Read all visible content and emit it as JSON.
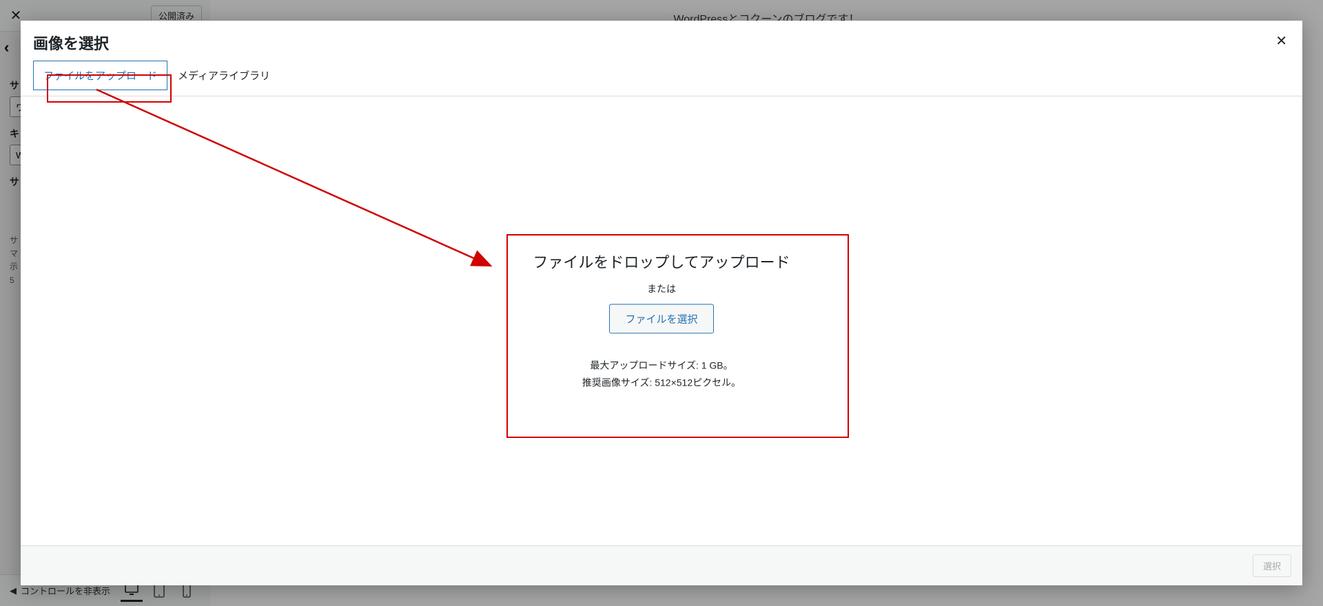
{
  "bg": {
    "close_icon": "✕",
    "publish_label": "公開済み",
    "preview_title": "WordPressとコクーンのブログです！",
    "back_icon": "‹",
    "panel": {
      "label1": "サ",
      "label2": "キ",
      "label3": "サ",
      "desc_line1": "サ",
      "desc_line2": "マ",
      "desc_line3": "示",
      "desc_line4": "5"
    },
    "footer": {
      "collapse_label": "コントロールを非表示"
    }
  },
  "modal": {
    "title": "画像を選択",
    "close_icon": "✕",
    "tabs": {
      "upload": "ファイルをアップロード",
      "library": "メディアライブラリ"
    },
    "upload": {
      "drop_title": "ファイルをドロップしてアップロード",
      "or_label": "または",
      "select_btn": "ファイルを選択",
      "max_size": "最大アップロードサイズ: 1 GB。",
      "recommended": "推奨画像サイズ: 512×512ピクセル。"
    },
    "footer": {
      "select_label": "選択"
    }
  }
}
